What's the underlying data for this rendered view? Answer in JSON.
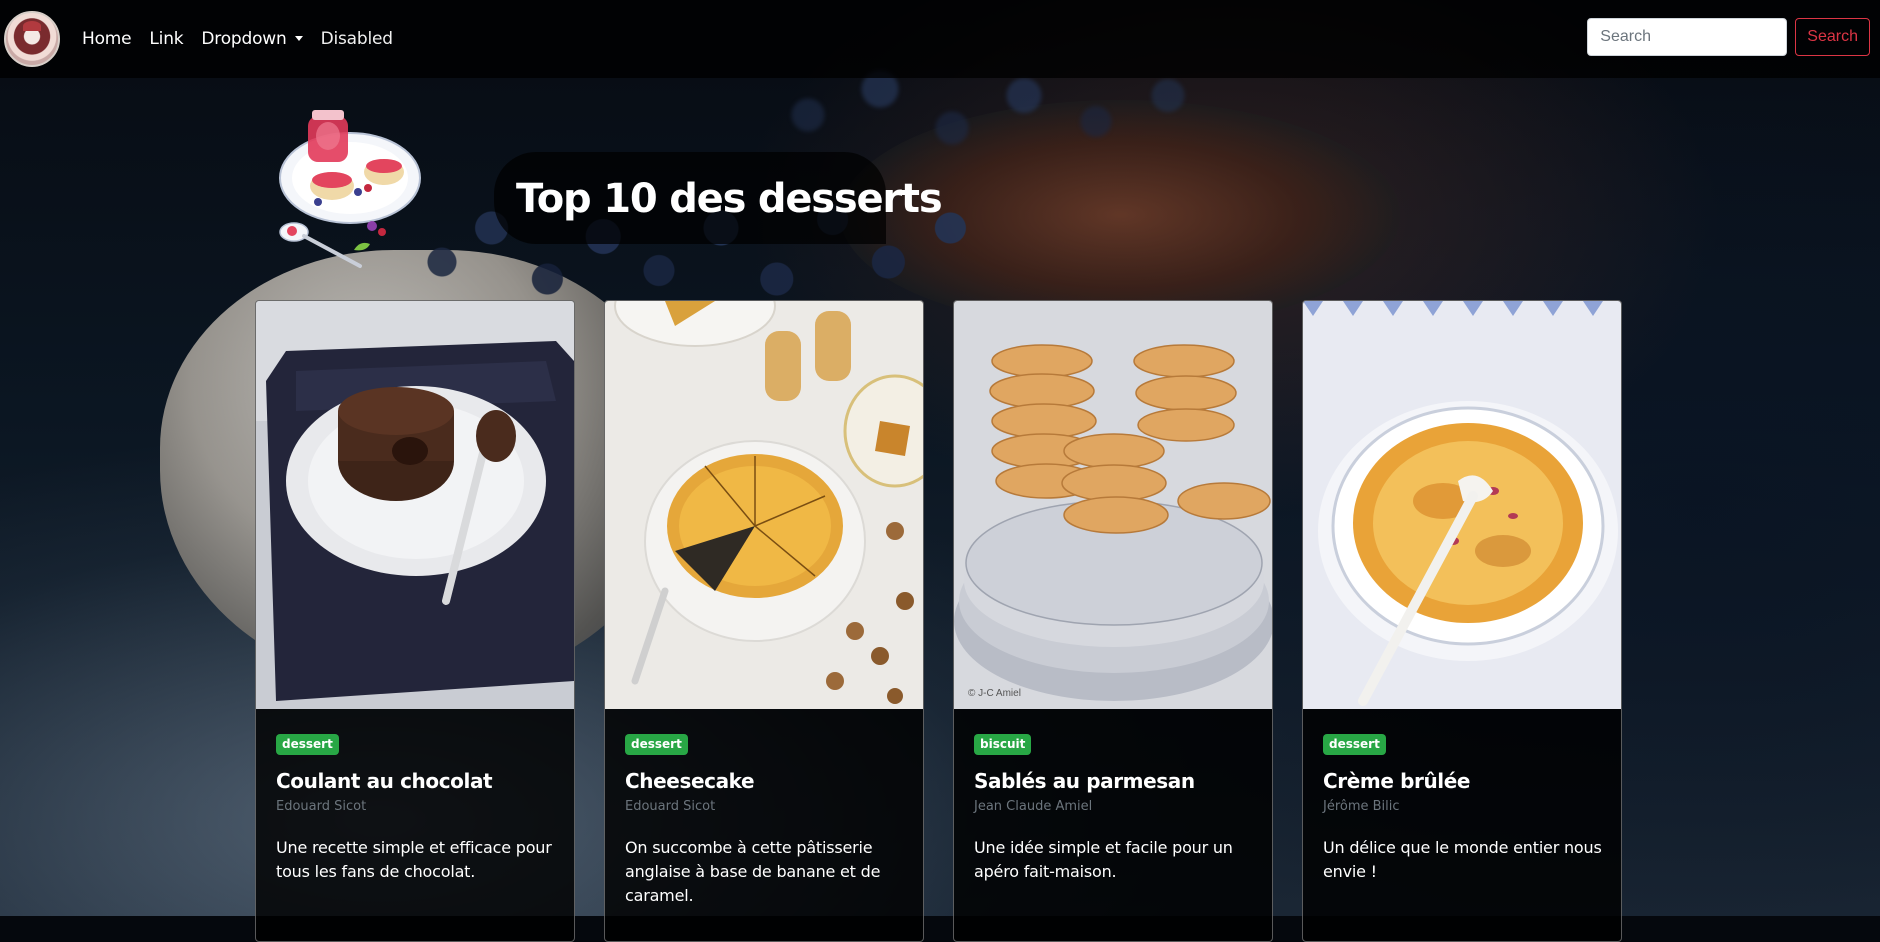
{
  "navbar": {
    "brand_alt": "Dessert logo",
    "links": [
      {
        "label": "Home"
      },
      {
        "label": "Link"
      },
      {
        "label": "Dropdown"
      },
      {
        "label": "Disabled"
      }
    ],
    "search": {
      "placeholder": "Search",
      "button_label": "Search"
    }
  },
  "hero": {
    "title": "Top 10 des desserts"
  },
  "cards": [
    {
      "badge": "dessert",
      "title": "Coulant au chocolat",
      "author": "Edouard Sicot",
      "text": "Une recette simple et efficace pour tous les fans de chocolat.",
      "photo_credit": ""
    },
    {
      "badge": "dessert",
      "title": "Cheesecake",
      "author": "Edouard Sicot",
      "text": "On succombe à cette pâtisserie anglaise à base de banane et de caramel.",
      "photo_credit": ""
    },
    {
      "badge": "biscuit",
      "title": "Sablés au parmesan",
      "author": "Jean Claude Amiel",
      "text": "Une idée simple et facile pour un apéro fait-maison.",
      "photo_credit": "© J-C Amiel"
    },
    {
      "badge": "dessert",
      "title": "Crème brûlée",
      "author": "Jérôme Bilic",
      "text": "Un délice que le monde entier nous envie !",
      "photo_credit": ""
    }
  ],
  "colors": {
    "badge": "#28a745",
    "search_button": "#dc3545",
    "subtitle": "#6c757d"
  }
}
